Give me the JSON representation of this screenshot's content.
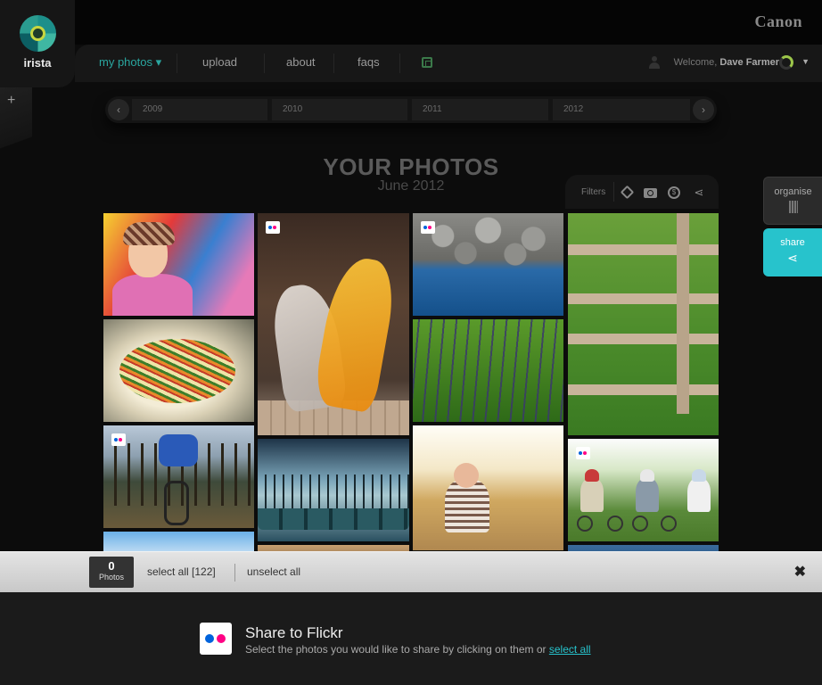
{
  "brand": {
    "app_name": "irista",
    "partner": "Canon"
  },
  "nav": {
    "items": [
      {
        "label": "my photos ▾"
      },
      {
        "label": "upload"
      },
      {
        "label": "about"
      },
      {
        "label": "faqs"
      }
    ],
    "welcome_prefix": "Welcome,",
    "user_name": "Dave Farmer"
  },
  "sidebar": {
    "add_label": "+"
  },
  "timeline": {
    "prev_icon": "‹",
    "next_icon": "›",
    "years": [
      "2009",
      "2010",
      "2011",
      "2012"
    ]
  },
  "gallery": {
    "title": "YOUR PHOTOS",
    "subtitle": "June 2012",
    "filters_label": "Filters",
    "filter_icons": [
      "tag-icon",
      "camera-icon",
      "coin-icon",
      "share-icon"
    ]
  },
  "tools": {
    "organise_label": "organise",
    "share_label": "share",
    "share_glyph": "⋖"
  },
  "photos": [
    {
      "name": "girl-in-playground",
      "flickr": false
    },
    {
      "name": "salad-plate",
      "flickr": false
    },
    {
      "name": "mountain-biker",
      "flickr": true
    },
    {
      "name": "sky-tower",
      "flickr": false
    },
    {
      "name": "dancers",
      "flickr": true
    },
    {
      "name": "gondolas-venice",
      "flickr": false
    },
    {
      "name": "wooden-table",
      "flickr": false
    },
    {
      "name": "rocks-sea",
      "flickr": true
    },
    {
      "name": "lavender-field",
      "flickr": false
    },
    {
      "name": "child-on-bike",
      "flickr": false
    },
    {
      "name": "wooden-fence",
      "flickr": false
    },
    {
      "name": "family-cycling",
      "flickr": true
    },
    {
      "name": "blue-partial",
      "flickr": false
    }
  ],
  "selection": {
    "count": "0",
    "count_label": "Photos",
    "select_all": "select all [122]",
    "unselect_all": "unselect all",
    "close": "✖"
  },
  "share_panel": {
    "title": "Share to Flickr",
    "description": "Select the photos you would like to share by clicking on them or",
    "link": "select all"
  },
  "colors": {
    "accent": "#27c3cc",
    "nav_active": "#2aa7a0",
    "flickr_blue": "#0063dc",
    "flickr_pink": "#ff0084"
  }
}
